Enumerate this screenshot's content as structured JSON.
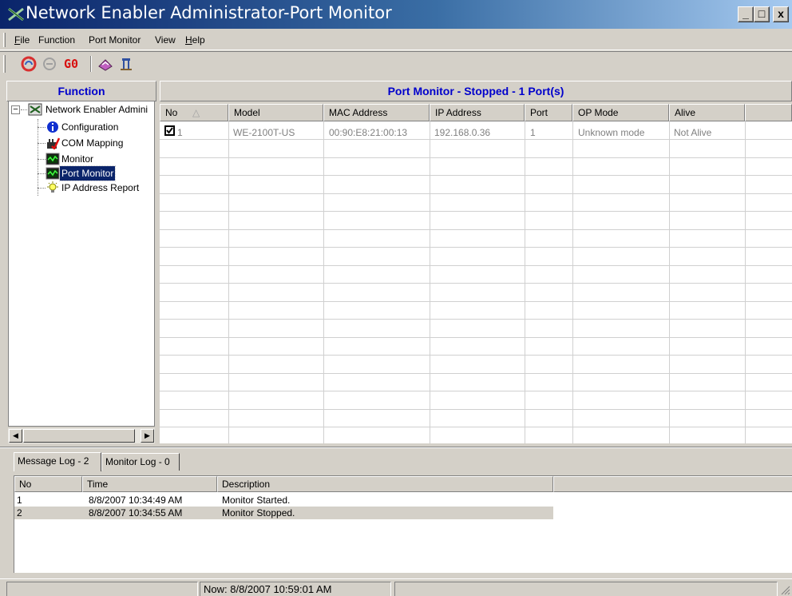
{
  "window": {
    "title": "Network Enabler Administrator-Port Monitor",
    "minimize": "_",
    "maximize": "□",
    "close": "x"
  },
  "menu": [
    {
      "label": "File",
      "accel": "F",
      "rest": "ile"
    },
    {
      "label": "Function",
      "accel": "",
      "rest": "Function"
    },
    {
      "label": "Port Monitor",
      "accel": "",
      "rest": "Port Monitor"
    },
    {
      "label": "View",
      "accel": "",
      "rest": "View"
    },
    {
      "label": "Help",
      "accel": "H",
      "rest": "elp"
    }
  ],
  "toolbar": {
    "go_label": "G0",
    "icons": [
      "refresh-icon",
      "stop-icon",
      "go-icon",
      "settings-tool-icon",
      "exit-icon"
    ]
  },
  "function_panel": {
    "header": "Function",
    "tree": {
      "root": "Network Enabler Admini",
      "collapse_glyph": "−",
      "items": [
        {
          "label": "Configuration",
          "icon": "info-icon"
        },
        {
          "label": "COM Mapping",
          "icon": "com-mapping-icon"
        },
        {
          "label": "Monitor",
          "icon": "monitor-icon"
        },
        {
          "label": "Port Monitor",
          "icon": "port-monitor-icon",
          "selected": true
        },
        {
          "label": "IP Address Report",
          "icon": "lightbulb-icon"
        }
      ]
    }
  },
  "port_panel": {
    "header": "Port Monitor - Stopped - 1 Port(s)",
    "columns": [
      "No",
      "Model",
      "MAC Address",
      "IP Address",
      "Port",
      "OP Mode",
      "Alive"
    ],
    "sort_indicator": "△",
    "rows": [
      {
        "checked": true,
        "no": "1",
        "model": "WE-2100T-US",
        "mac": "00:90:E8:21:00:13",
        "ip": "192.168.0.36",
        "port": "1",
        "op_mode": "Unknown mode",
        "alive": "Not Alive"
      }
    ]
  },
  "tabs": [
    {
      "label": "Message Log - 2",
      "active": true
    },
    {
      "label": "Monitor Log - 0",
      "active": false
    }
  ],
  "log": {
    "columns": [
      "No",
      "Time",
      "Description"
    ],
    "rows": [
      {
        "no": "1",
        "time": "8/8/2007 10:34:49 AM",
        "description": "Monitor Started."
      },
      {
        "no": "2",
        "time": "8/8/2007 10:34:55 AM",
        "description": "Monitor Stopped."
      }
    ]
  },
  "status": {
    "now": "Now: 8/8/2007 10:59:01 AM"
  }
}
